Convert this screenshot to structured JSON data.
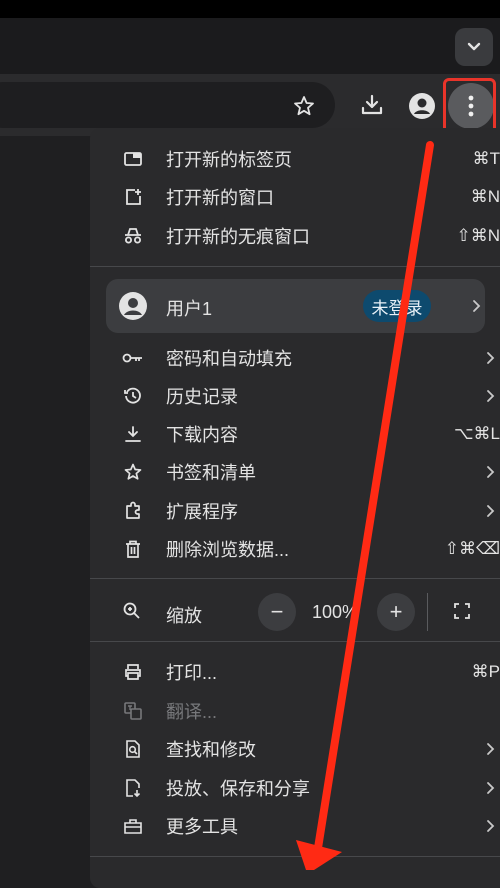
{
  "menu": {
    "new_tab": {
      "label": "打开新的标签页",
      "shortcut": "⌘T"
    },
    "new_window": {
      "label": "打开新的窗口",
      "shortcut": "⌘N"
    },
    "new_incognito": {
      "label": "打开新的无痕窗口",
      "shortcut": "⇧⌘N"
    },
    "profile": {
      "label": "用户1",
      "badge": "未登录"
    },
    "passwords": {
      "label": "密码和自动填充"
    },
    "history": {
      "label": "历史记录"
    },
    "downloads": {
      "label": "下载内容",
      "shortcut": "⌥⌘L"
    },
    "bookmarks": {
      "label": "书签和清单"
    },
    "extensions": {
      "label": "扩展程序"
    },
    "clear_data": {
      "label": "删除浏览数据...",
      "shortcut": "⇧⌘⌫"
    },
    "zoom": {
      "label": "缩放",
      "minus": "−",
      "value": "100%",
      "plus": "+"
    },
    "print": {
      "label": "打印...",
      "shortcut": "⌘P"
    },
    "translate": {
      "label": "翻译..."
    },
    "find_edit": {
      "label": "查找和修改"
    },
    "cast_save_share": {
      "label": "投放、保存和分享"
    },
    "more_tools": {
      "label": "更多工具"
    }
  },
  "colors": {
    "highlight": "#e9342a",
    "badge": "#0d4a6e",
    "menu_bg": "#2a2a2c"
  }
}
